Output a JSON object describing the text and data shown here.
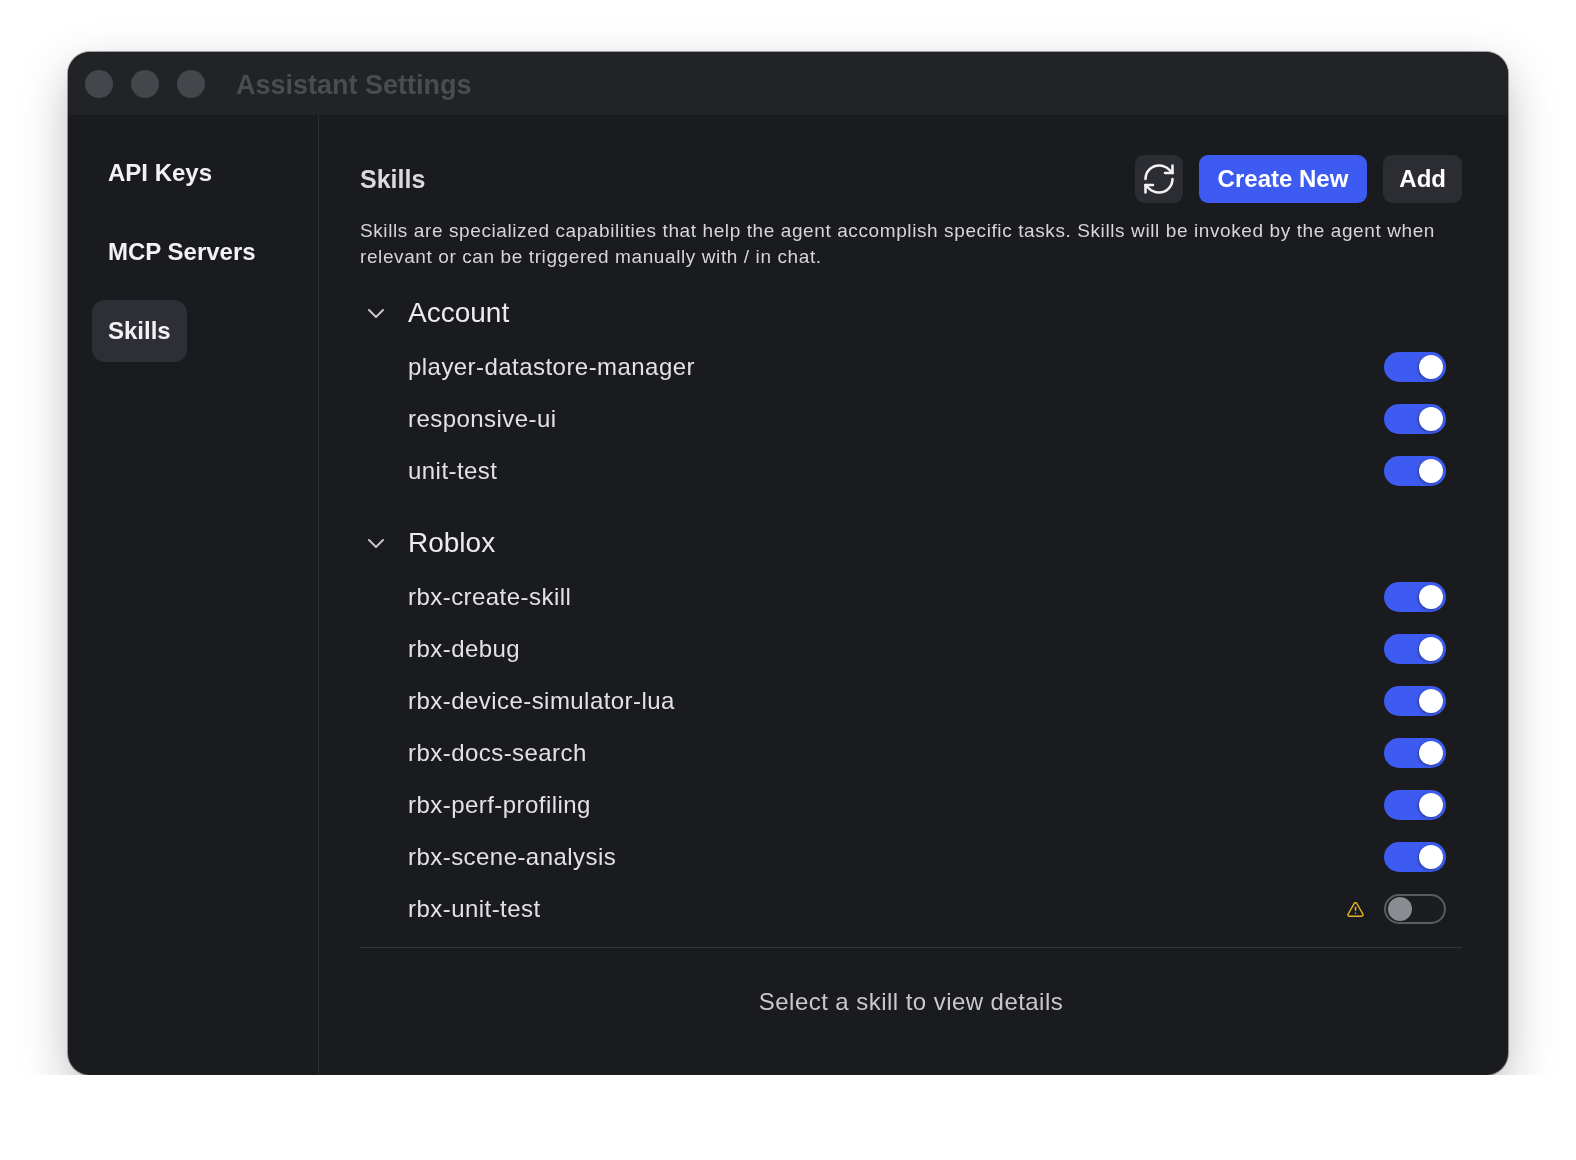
{
  "window": {
    "title": "Assistant Settings"
  },
  "sidebar": {
    "items": [
      {
        "label": "API Keys",
        "selected": false
      },
      {
        "label": "MCP Servers",
        "selected": false
      },
      {
        "label": "Skills",
        "selected": true
      }
    ]
  },
  "skills": {
    "title": "Skills",
    "actions": [
      {
        "kind": "refresh"
      },
      {
        "kind": "primary",
        "label": "Create New"
      },
      {
        "kind": "secondary",
        "label": "Add"
      }
    ],
    "description": "Skills are specialized capabilities that help the agent accomplish specific tasks. Skills will be invoked by the agent when relevant or can be triggered manually with / in chat.",
    "groups": [
      {
        "name": "Account",
        "expanded": true,
        "items": [
          {
            "name": "player-datastore-manager",
            "on": true,
            "warning": false
          },
          {
            "name": "responsive-ui",
            "on": true,
            "warning": false
          },
          {
            "name": "unit-test",
            "on": true,
            "warning": false
          }
        ]
      },
      {
        "name": "Roblox",
        "expanded": true,
        "items": [
          {
            "name": "rbx-create-skill",
            "on": true,
            "warning": false
          },
          {
            "name": "rbx-debug",
            "on": true,
            "warning": false
          },
          {
            "name": "rbx-device-simulator-lua",
            "on": true,
            "warning": false
          },
          {
            "name": "rbx-docs-search",
            "on": true,
            "warning": false
          },
          {
            "name": "rbx-perf-profiling",
            "on": true,
            "warning": false
          },
          {
            "name": "rbx-scene-analysis",
            "on": true,
            "warning": false
          },
          {
            "name": "rbx-unit-test",
            "on": false,
            "warning": true
          }
        ]
      }
    ]
  },
  "details": {
    "message": "Select a skill to view details"
  }
}
